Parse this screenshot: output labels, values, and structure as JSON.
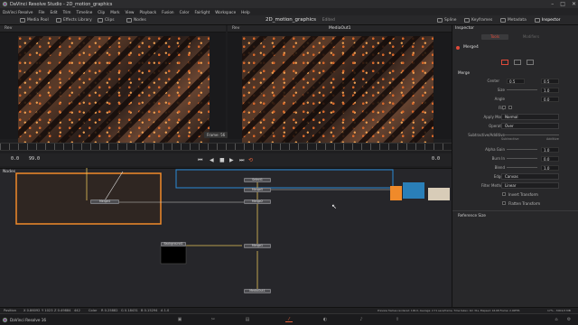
{
  "window": {
    "title": "DaVinci Resolve Studio - 2D_motion_graphics"
  },
  "menu": [
    "DaVinci Resolve",
    "File",
    "Edit",
    "Trim",
    "Timeline",
    "Clip",
    "Mark",
    "View",
    "Playback",
    "Fusion",
    "Color",
    "Fairlight",
    "Workspace",
    "Help"
  ],
  "toolbar": {
    "media_pool": "Media Pool",
    "effects_library": "Effects Library",
    "clips": "Clips",
    "nodes": "Nodes",
    "project_name": "2D_motion_graphics",
    "edited": "Edited",
    "spline": "Spline",
    "keyframes": "Keyframes",
    "metadata": "Metadata",
    "inspector": "Inspector"
  },
  "viewer": {
    "left_label": "Rev",
    "right_label": "Rev",
    "right_title": "MediaOut1",
    "frame_label": "Frame: 56"
  },
  "transport": {
    "tc_in": "0.0",
    "tc_out": "99.0",
    "tc_current": "0.0"
  },
  "nodes": {
    "title": "Nodes",
    "merge4": "Merge4",
    "node_a": "Select1",
    "node_b": "Merge5",
    "node_c": "Merge2",
    "background": "Background1",
    "merge_main": "Merge1",
    "media_out": "MediaOut1"
  },
  "inspector": {
    "title": "Inspector",
    "tab_tools": "Tools",
    "tab_modifiers": "Modifiers",
    "tool_name": "Merge4",
    "section_merge": "Merge",
    "center_label": "Center",
    "center_x": "0.5",
    "center_y": "0.5",
    "size_label": "Size",
    "size_value": "1.0",
    "angle_label": "Angle",
    "angle_value": "0.0",
    "flip_label": "Flip",
    "apply_mode_label": "Apply Mode",
    "apply_mode_value": "Normal",
    "operator_label": "Operator",
    "operator_value": "Over",
    "subtractive_label": "Subtractive/Additive",
    "subtractive_left": "Subtractive",
    "subtractive_right": "Additive",
    "alpha_gain_label": "Alpha Gain",
    "alpha_gain_value": "1.0",
    "burn_in_label": "Burn In",
    "burn_in_value": "0.0",
    "blend_label": "Blend",
    "blend_value": "1.0",
    "edges_label": "Edges",
    "edges_value": "Canvas",
    "filter_method_label": "Filter Method",
    "filter_method_value": "Linear",
    "invert_transform": "Invert Transform",
    "flatten_transform": "Flatten Transform",
    "reference_size": "Reference Size"
  },
  "status": {
    "position_label": "Position",
    "pos_x": "X 0.86092",
    "pos_y": "Y 1023",
    "pos_z": "Z 0.49884",
    "pos_w": "442",
    "color_label": "Color",
    "color_r": "R 0.25882",
    "color_g": "G 0.18431",
    "color_b": "B 0.15294",
    "color_a": "A 1.0",
    "render_info": "Preview frames rendered: 100.0, Average: 2.71 secs/frame, Time taken: 4m 31s, Elapsed: 16.68 Frame: 2.00FPS",
    "mem": "17% - 3001/3 MB"
  },
  "app_label": "DaVinci Resolve 16",
  "colors": {
    "accent_orange": "#f08a2a",
    "accent_blue": "#2a8bd6",
    "link_yellow": "#e6c45a",
    "bg": "#1e1e20"
  }
}
